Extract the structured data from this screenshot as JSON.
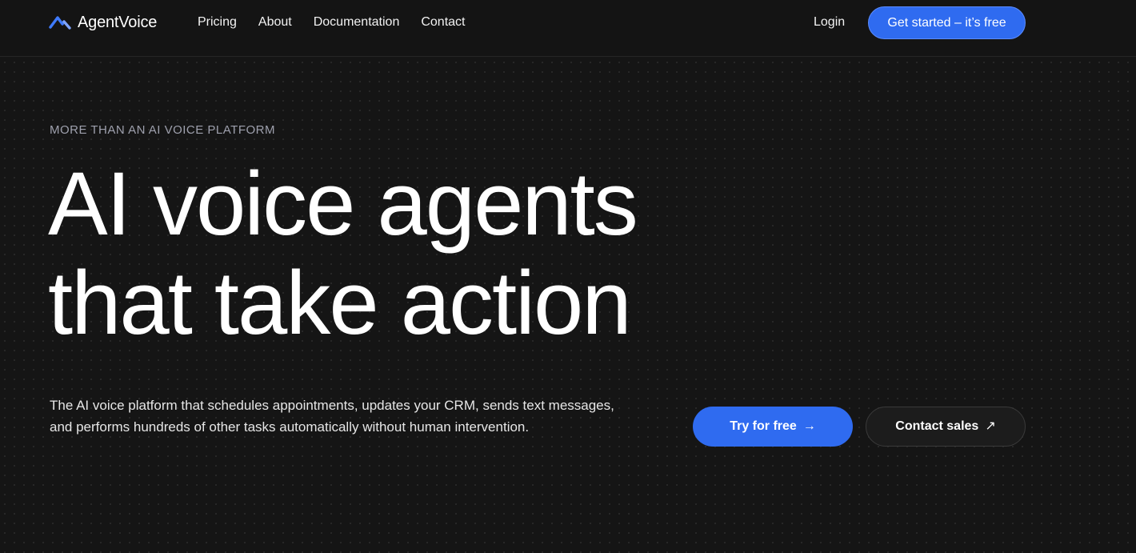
{
  "brand": {
    "name": "AgentVoice",
    "logo_icon": "wave-chevron-icon",
    "accent_color": "#2f6bf0"
  },
  "nav": {
    "links": [
      "Pricing",
      "About",
      "Documentation",
      "Contact"
    ],
    "login_label": "Login",
    "cta_label": "Get started – it’s free"
  },
  "hero": {
    "eyebrow": "MORE THAN AN AI VOICE PLATFORM",
    "headline_line1": "AI voice agents",
    "headline_line2": "that take action",
    "subtext": "The AI voice platform that schedules appointments, updates your CRM, sends text messages, and performs hundreds of other tasks automatically without human intervention.",
    "primary_button": {
      "label": "Try for free",
      "icon": "arrow-right-icon",
      "glyph": "→"
    },
    "secondary_button": {
      "label": "Contact sales",
      "icon": "arrow-up-right-icon",
      "glyph": "↗"
    }
  }
}
